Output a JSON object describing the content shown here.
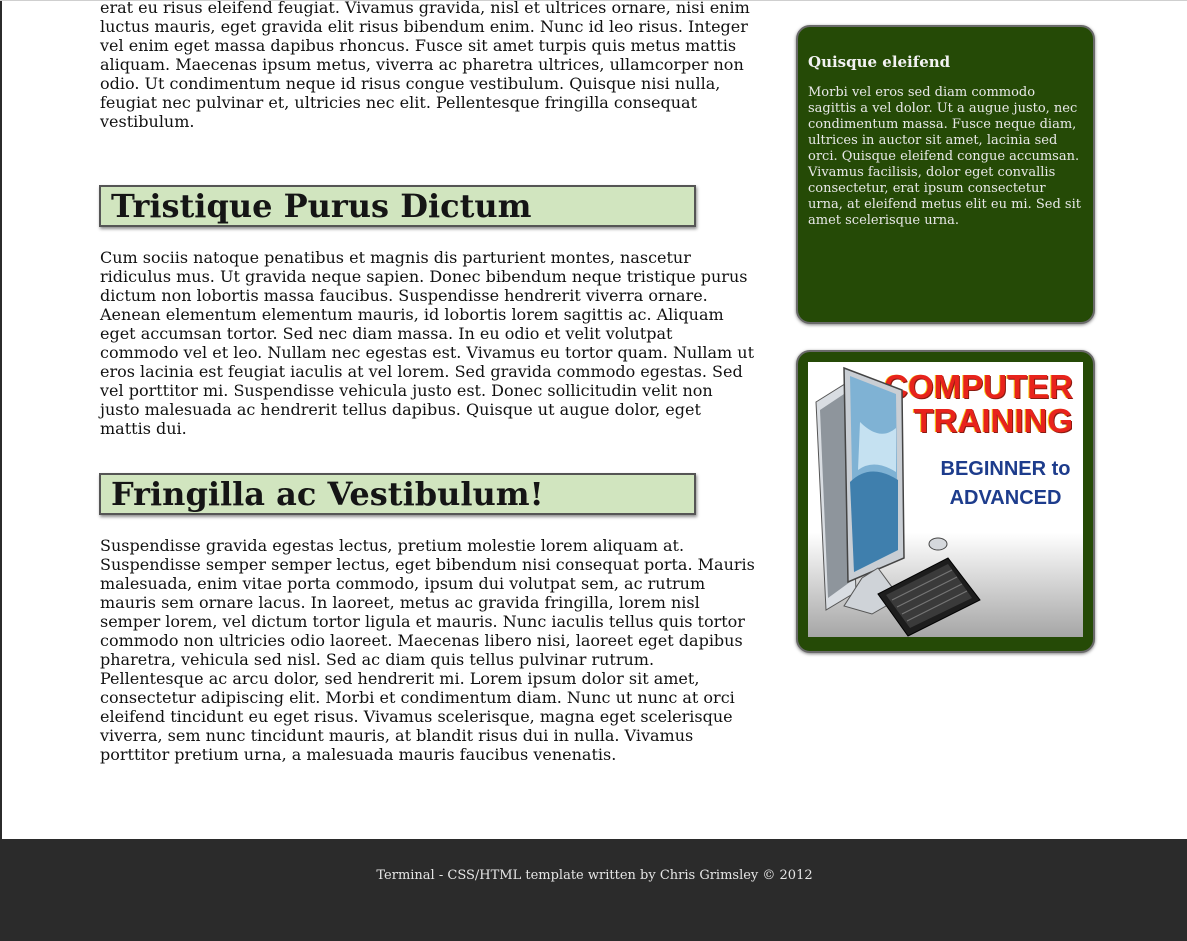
{
  "main": {
    "intro_paragraph": "erat eu risus eleifend feugiat. Vivamus gravida, nisl et ultrices ornare, nisi enim luctus mauris, eget gravida elit risus bibendum enim. Nunc id leo risus. Integer vel enim eget massa dapibus rhoncus. Fusce sit amet turpis quis metus mattis aliquam. Maecenas ipsum metus, viverra ac pharetra ultrices, ullamcorper non odio. Ut condimentum neque id risus congue vestibulum. Quisque nisi nulla, feugiat nec pulvinar et, ultricies nec elit. Pellentesque fringilla consequat vestibulum.",
    "sections": [
      {
        "heading": "Tristique Purus Dictum",
        "body": "Cum sociis natoque penatibus et magnis dis parturient montes, nascetur ridiculus mus. Ut gravida neque sapien. Donec bibendum neque tristique purus dictum non lobortis massa faucibus. Suspendisse hendrerit viverra ornare. Aenean elementum elementum mauris, id lobortis lorem sagittis ac. Aliquam eget accumsan tortor. Sed nec diam massa. In eu odio et velit volutpat commodo vel et leo. Nullam nec egestas est. Vivamus eu tortor quam. Nullam ut eros lacinia est feugiat iaculis at vel lorem. Sed gravida commodo egestas. Sed vel porttitor mi. Suspendisse vehicula justo est. Donec sollicitudin velit non justo malesuada ac hendrerit tellus dapibus. Quisque ut augue dolor, eget mattis dui."
      },
      {
        "heading": "Fringilla ac Vestibulum!",
        "body": "Suspendisse gravida egestas lectus, pretium molestie lorem aliquam at. Suspendisse semper semper lectus, eget bibendum nisi consequat porta. Mauris malesuada, enim vitae porta commodo, ipsum dui volutpat sem, ac rutrum mauris sem ornare lacus. In laoreet, metus ac gravida fringilla, lorem nisl semper lorem, vel dictum tortor ligula et mauris. Nunc iaculis tellus quis tortor commodo non ultricies odio laoreet. Maecenas libero nisi, laoreet eget dapibus pharetra, vehicula sed nisl. Sed ac diam quis tellus pulvinar rutrum. Pellentesque ac arcu dolor, sed hendrerit mi. Lorem ipsum dolor sit amet, consectetur adipiscing elit. Morbi et condimentum diam. Nunc ut nunc at orci eleifend tincidunt eu eget risus. Vivamus scelerisque, magna eget scelerisque viverra, sem nunc tincidunt mauris, at blandit risus dui in nulla. Vivamus porttitor pretium urna, a malesuada mauris faucibus venenatis."
      }
    ]
  },
  "sidebar": {
    "box_title": "Quisque eleifend",
    "box_text": "Morbi vel eros sed diam commodo sagittis a vel dolor. Ut a augue justo, nec condimentum massa. Fusce neque diam, ultrices in auctor sit amet, lacinia sed orci. Quisque eleifend congue accumsan. Vivamus facilisis, dolor eget convallis consectetur, erat ipsum consectetur urna, at eleifend metus elit eu mi. Sed sit amet scelerisque urna.",
    "promo": {
      "line1": "COMPUTER",
      "line2": "TRAINING",
      "line3": "BEGINNER to",
      "line4": "ADVANCED"
    }
  },
  "footer": {
    "text": "Terminal - CSS/HTML template written by Chris Grimsley © 2012"
  },
  "colors": {
    "heading_bg": "#d1e5bf",
    "sidebar_bg": "#254a06",
    "footer_bg": "#2b2b2b",
    "promo_red": "#e8231c",
    "promo_blue": "#1d3c8c"
  },
  "icons": [
    "computer-monitor-icon",
    "keyboard-icon"
  ]
}
